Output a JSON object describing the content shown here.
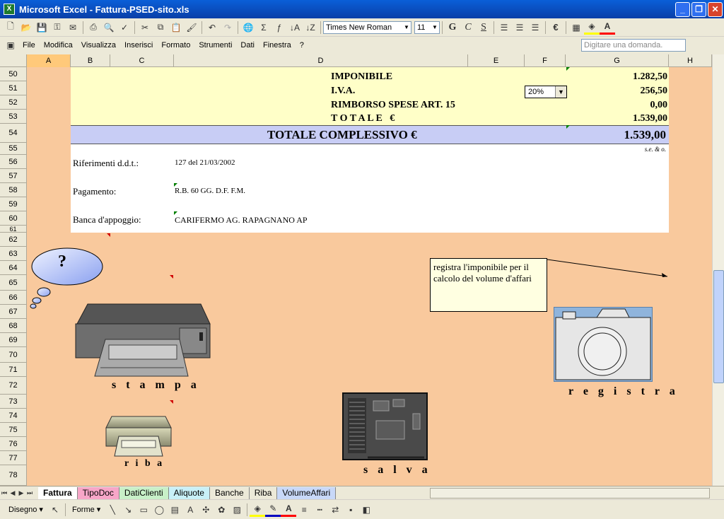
{
  "window": {
    "title": "Microsoft Excel - Fattura-PSED-sito.xls",
    "app_icon": "excel-icon"
  },
  "toolbar": {
    "font_name": "Times New Roman",
    "font_size": "11",
    "bold_glyph": "G",
    "italic_glyph": "C",
    "underline_glyph": "S",
    "sum_glyph": "Σ",
    "currency_glyph": "€"
  },
  "menu": {
    "items": [
      "File",
      "Modifica",
      "Visualizza",
      "Inserisci",
      "Formato",
      "Strumenti",
      "Dati",
      "Finestra",
      "?"
    ],
    "ask_placeholder": "Digitare una domanda."
  },
  "columns": [
    "A",
    "B",
    "C",
    "D",
    "E",
    "F",
    "G",
    "H"
  ],
  "rows": [
    "50",
    "51",
    "52",
    "53",
    "54",
    "55",
    "56",
    "57",
    "58",
    "59",
    "60",
    "61",
    "62",
    "63",
    "64",
    "65",
    "66",
    "67",
    "68",
    "69",
    "70",
    "71",
    "72",
    "73",
    "74",
    "75",
    "76",
    "77",
    "78"
  ],
  "invoice": {
    "imponibile_label": "IMPONIBILE",
    "imponibile_value": "1.282,50",
    "iva_label": "I.V.A.",
    "iva_rate": "20%",
    "iva_value": "256,50",
    "rimborso_label": "RIMBORSO SPESE ART. 15",
    "rimborso_value": "0,00",
    "totale_label": "T O T A L E   €",
    "totale_value": "1.539,00",
    "complessivo_label": "TOTALE COMPLESSIVO €",
    "complessivo_value": "1.539,00",
    "seo": "s.e. & o.",
    "rif_label": "Riferimenti d.d.t.:",
    "rif_value": "127 del 21/03/2002",
    "pag_label": "Pagamento:",
    "pag_value": "R.B. 60 GG. D.F. F.M.",
    "banca_label": "Banca d'appoggio:",
    "banca_value": "CARIFERMO AG. RAPAGNANO AP"
  },
  "buttons": {
    "stampa": "s t a m p a",
    "riba": "r i b a",
    "salva": "s a l v a",
    "registra": "r e g i s t r a",
    "help_glyph": "?"
  },
  "note": {
    "text": "registra l'imponibile per il calcolo del volume d'affari"
  },
  "sheet_tabs": [
    "Fattura",
    "TipoDoc",
    "DatiClienti",
    "Aliquote",
    "Banche",
    "Riba",
    "VolumeAffari"
  ],
  "drawing": {
    "disegno": "Disegno",
    "forme": "Forme"
  },
  "colors": {
    "sheet_bg": "#f9c99d",
    "total_band": "#c8cdf5",
    "header_band": "#ffffc8"
  }
}
